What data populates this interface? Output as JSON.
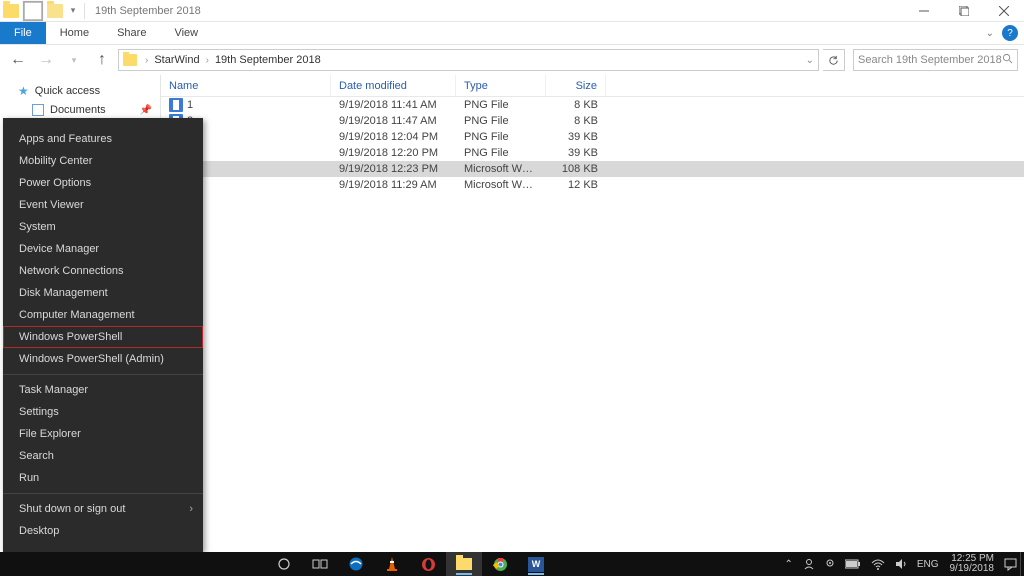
{
  "titlebar": {
    "title": "19th September 2018"
  },
  "ribbon": {
    "file": "File",
    "tabs": [
      "Home",
      "Share",
      "View"
    ]
  },
  "addressbar": {
    "segments": [
      "StarWind",
      "19th September 2018"
    ]
  },
  "searchbox": {
    "placeholder": "Search 19th September 2018"
  },
  "sidebar": {
    "quick_access": "Quick access",
    "documents": "Documents"
  },
  "columns": {
    "name": "Name",
    "date": "Date modified",
    "type": "Type",
    "size": "Size"
  },
  "files": [
    {
      "name": "1",
      "date": "9/19/2018 11:41 AM",
      "type": "PNG File",
      "size": "8 KB",
      "icon": "png",
      "selected": false,
      "show_icon": true
    },
    {
      "name": "2",
      "date": "9/19/2018 11:47 AM",
      "type": "PNG File",
      "size": "8 KB",
      "icon": "png",
      "selected": false,
      "show_icon": true
    },
    {
      "name": "",
      "date": "9/19/2018 12:04 PM",
      "type": "PNG File",
      "size": "39 KB",
      "icon": "png",
      "selected": false,
      "show_icon": false
    },
    {
      "name": "",
      "date": "9/19/2018 12:20 PM",
      "type": "PNG File",
      "size": "39 KB",
      "icon": "png",
      "selected": false,
      "show_icon": false
    },
    {
      "name": "",
      "date": "9/19/2018 12:23 PM",
      "type": "Microsoft Word D...",
      "size": "108 KB",
      "icon": "word",
      "selected": true,
      "show_icon": false
    },
    {
      "name": "",
      "date": "9/19/2018 11:29 AM",
      "type": "Microsoft Word D...",
      "size": "12 KB",
      "icon": "word",
      "selected": false,
      "show_icon": false
    }
  ],
  "winx": {
    "groups": [
      [
        "Apps and Features",
        "Mobility Center",
        "Power Options",
        "Event Viewer",
        "System",
        "Device Manager",
        "Network Connections",
        "Disk Management",
        "Computer Management",
        "Windows PowerShell",
        "Windows PowerShell (Admin)"
      ],
      [
        "Task Manager",
        "Settings",
        "File Explorer",
        "Search",
        "Run"
      ],
      [
        "Shut down or sign out",
        "Desktop"
      ]
    ],
    "highlighted": "Windows PowerShell",
    "has_submenu": [
      "Shut down or sign out"
    ]
  },
  "tray": {
    "lang": "ENG",
    "time": "12:25 PM",
    "date": "9/19/2018"
  }
}
